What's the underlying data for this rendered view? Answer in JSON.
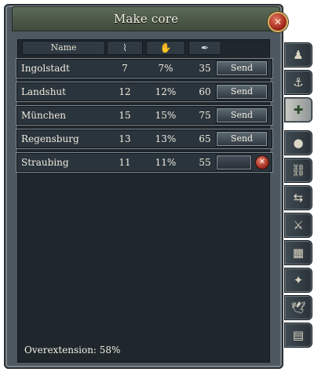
{
  "window": {
    "title": "Make core"
  },
  "columns": {
    "name": "Name",
    "col_a_icon": "graph-icon",
    "col_b_icon": "hands-icon",
    "col_c_icon": "quill-icon"
  },
  "rows": [
    {
      "name": "Ingolstadt",
      "a": "7",
      "b": "7%",
      "c": "35",
      "action": "Send"
    },
    {
      "name": "Landshut",
      "a": "12",
      "b": "12%",
      "c": "60",
      "action": "Send"
    },
    {
      "name": "München",
      "a": "15",
      "b": "15%",
      "c": "75",
      "action": "Send"
    },
    {
      "name": "Regensburg",
      "a": "13",
      "b": "13%",
      "c": "65",
      "action": "Send"
    },
    {
      "name": "Straubing",
      "a": "11",
      "b": "11%",
      "c": "55",
      "action": ""
    }
  ],
  "footer": {
    "overextension": "Overextension: 58%"
  },
  "tabs": [
    {
      "icon": "diplomat-icon"
    },
    {
      "icon": "fleet-icon"
    },
    {
      "icon": "make-core-icon",
      "active": true
    },
    {
      "icon": "religion-icon"
    },
    {
      "icon": "chain-icon"
    },
    {
      "icon": "colonist-icon"
    },
    {
      "icon": "soldiers-icon"
    },
    {
      "icon": "map-icon"
    },
    {
      "icon": "conversion-icon"
    },
    {
      "icon": "dove-icon"
    },
    {
      "icon": "map-scroll-icon"
    }
  ],
  "colors": {
    "window": "#4d5860",
    "content": "#1f272d",
    "title_bar": "#4f5c4b",
    "text": "#f0ecdf",
    "close": "#b33a27"
  }
}
